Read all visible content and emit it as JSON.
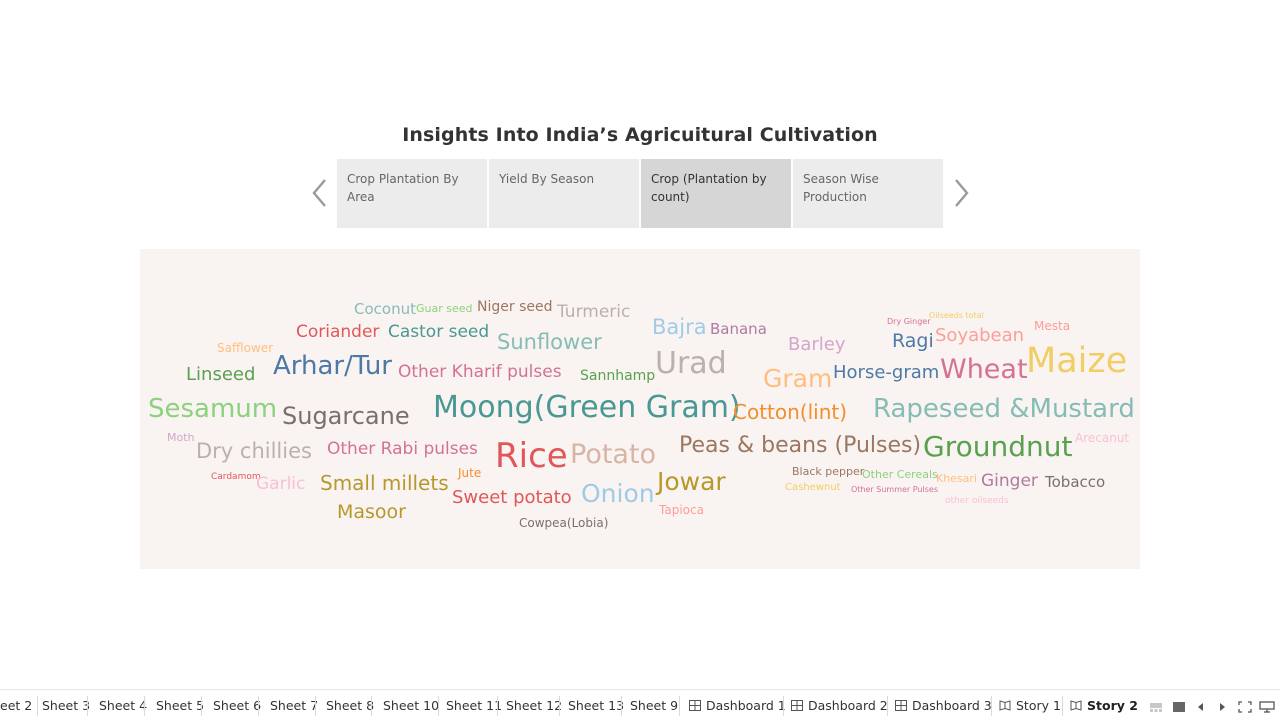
{
  "story": {
    "title": "Insights Into India’s Agricuitural Cultivation",
    "points": [
      {
        "label": "Crop Plantation By Area",
        "active": false
      },
      {
        "label": "Yield By Season",
        "active": false
      },
      {
        "label": "Crop (Plantation by count)",
        "active": true
      },
      {
        "label": "Season Wise Production",
        "active": false
      }
    ],
    "prev_icon": "chevron-left-icon",
    "next_icon": "chevron-right-icon"
  },
  "wordcloud": {
    "background": "#f9f4f1",
    "words": [
      {
        "text": "Coconut",
        "color": "#86bcb6"
      },
      {
        "text": "Guar seed",
        "color": "#8cd17d"
      },
      {
        "text": "Niger seed",
        "color": "#9d7660"
      },
      {
        "text": "Turmeric",
        "color": "#bab0ac"
      },
      {
        "text": "Coriander",
        "color": "#e15759"
      },
      {
        "text": "Castor seed",
        "color": "#499894"
      },
      {
        "text": "Sunflower",
        "color": "#86bcb6"
      },
      {
        "text": "Safflower",
        "color": "#ffbe7d"
      },
      {
        "text": "Linseed",
        "color": "#59a14f"
      },
      {
        "text": "Arhar/Tur",
        "color": "#4e79a7"
      },
      {
        "text": "Other Kharif pulses",
        "color": "#d37295"
      },
      {
        "text": "Sannhamp",
        "color": "#59a14f"
      },
      {
        "text": "Sesamum",
        "color": "#8cd17d"
      },
      {
        "text": "Sugarcane",
        "color": "#79706e"
      },
      {
        "text": "Moong(Green Gram)",
        "color": "#499894"
      },
      {
        "text": "Moth",
        "color": "#d4a6c8"
      },
      {
        "text": "Dry chillies",
        "color": "#bab0ac"
      },
      {
        "text": "Other Rabi pulses",
        "color": "#d37295"
      },
      {
        "text": "Cardamom",
        "color": "#e15759"
      },
      {
        "text": "Garlic",
        "color": "#fabfd2"
      },
      {
        "text": "Jute",
        "color": "#f28e2b"
      },
      {
        "text": "Small millets",
        "color": "#b6992d"
      },
      {
        "text": "Rice",
        "color": "#e15759"
      },
      {
        "text": "Potato",
        "color": "#d7b5a6"
      },
      {
        "text": "Sweet potato",
        "color": "#e15759"
      },
      {
        "text": "Onion",
        "color": "#a0cbe8"
      },
      {
        "text": "Masoor",
        "color": "#b6992d"
      },
      {
        "text": "Cowpea(Lobia)",
        "color": "#79706e"
      },
      {
        "text": "Bajra",
        "color": "#a0cbe8"
      },
      {
        "text": "Banana",
        "color": "#b07aa1"
      },
      {
        "text": "Urad",
        "color": "#bab0ac"
      },
      {
        "text": "Gram",
        "color": "#ffbe7d"
      },
      {
        "text": "Barley",
        "color": "#d4a6c8"
      },
      {
        "text": "Ragi",
        "color": "#4e79a7"
      },
      {
        "text": "Horse-gram",
        "color": "#4e79a7"
      },
      {
        "text": "Cotton(lint)",
        "color": "#f28e2b"
      },
      {
        "text": "Peas & beans (Pulses)",
        "color": "#9d7660"
      },
      {
        "text": "Jowar",
        "color": "#b6992d"
      },
      {
        "text": "Tapioca",
        "color": "#ff9d9a"
      },
      {
        "text": "Dry Ginger",
        "color": "#d37295"
      },
      {
        "text": "Oilseeds total",
        "color": "#f1ce63"
      },
      {
        "text": "Mesta",
        "color": "#ff9d9a"
      },
      {
        "text": "Soyabean",
        "color": "#ff9d9a"
      },
      {
        "text": "Wheat",
        "color": "#d37295"
      },
      {
        "text": "Maize",
        "color": "#f1ce63"
      },
      {
        "text": "Rapeseed &Mustard",
        "color": "#86bcb6"
      },
      {
        "text": "Groundnut",
        "color": "#59a14f"
      },
      {
        "text": "Arecanut",
        "color": "#fabfd2"
      },
      {
        "text": "Black pepper",
        "color": "#9d7660"
      },
      {
        "text": "Other Cereals",
        "color": "#8cd17d"
      },
      {
        "text": "Khesari",
        "color": "#ffbe7d"
      },
      {
        "text": "Ginger",
        "color": "#b07aa1"
      },
      {
        "text": "Tobacco",
        "color": "#79706e"
      },
      {
        "text": "Cashewnut",
        "color": "#f1ce63"
      },
      {
        "text": "Other Summer Pulses",
        "color": "#d37295"
      },
      {
        "text": "other oilseeds",
        "color": "#fabfd2"
      }
    ]
  },
  "tabs": [
    {
      "label": "eet 2",
      "icon": ""
    },
    {
      "label": "Sheet 3",
      "icon": ""
    },
    {
      "label": "Sheet 4",
      "icon": ""
    },
    {
      "label": "Sheet 5",
      "icon": ""
    },
    {
      "label": "Sheet 6",
      "icon": ""
    },
    {
      "label": "Sheet 7",
      "icon": ""
    },
    {
      "label": "Sheet 8",
      "icon": ""
    },
    {
      "label": "Sheet 10",
      "icon": ""
    },
    {
      "label": "Sheet 11",
      "icon": ""
    },
    {
      "label": "Sheet 12",
      "icon": ""
    },
    {
      "label": "Sheet 13",
      "icon": ""
    },
    {
      "label": "Sheet 9",
      "icon": ""
    },
    {
      "label": "Dashboard 1",
      "icon": "dashboard-icon"
    },
    {
      "label": "Dashboard 2",
      "icon": "dashboard-icon"
    },
    {
      "label": "Dashboard 3",
      "icon": "dashboard-icon"
    },
    {
      "label": "Story 1",
      "icon": "story-icon"
    },
    {
      "label": "Story 2",
      "icon": "story-icon",
      "active": true
    }
  ],
  "controls": [
    "filmstrip-icon",
    "grid-view-icon",
    "previous-tab-icon",
    "next-tab-icon",
    "fit-screen-icon",
    "presentation-icon"
  ]
}
